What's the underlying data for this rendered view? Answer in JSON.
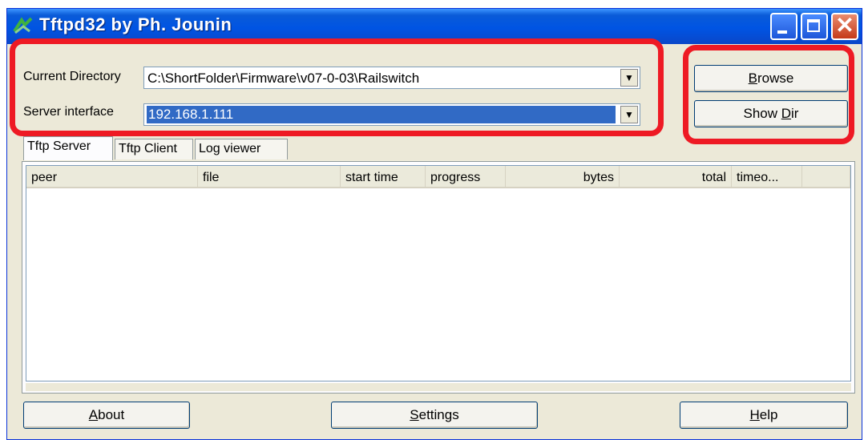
{
  "window": {
    "title": "Tftpd32 by Ph. Jounin"
  },
  "icons": {
    "app": "tftpd-app-icon",
    "minimize": "minimize-icon",
    "maximize": "maximize-icon",
    "close": "close-icon",
    "dropdown": "chevron-down-icon"
  },
  "colors": {
    "highlight": "#ee1a24",
    "titlebar": "#0054e3",
    "selection": "#316ac5"
  },
  "form": {
    "current_directory_label": "Current Directory",
    "current_directory_value": "C:\\ShortFolder\\Firmware\\v07-0-03\\Railswitch",
    "server_interface_label": "Server interface",
    "server_interface_value": "192.168.1.111",
    "dropdown_glyph": "▼"
  },
  "buttons": {
    "browse_pre": "",
    "browse_key": "B",
    "browse_post": "rowse",
    "showdir_pre": "Show ",
    "showdir_key": "D",
    "showdir_post": "ir",
    "about_pre": "",
    "about_key": "A",
    "about_post": "bout",
    "settings_pre": "",
    "settings_key": "S",
    "settings_post": "ettings",
    "help_pre": "",
    "help_key": "H",
    "help_post": "elp"
  },
  "tabs": [
    "Tftp Server",
    "Tftp Client",
    "Log viewer"
  ],
  "columns": [
    "peer",
    "file",
    "start time",
    "progress",
    "bytes",
    "total",
    "timeo..."
  ],
  "titlebar_glyphs": {
    "close": "✕"
  }
}
